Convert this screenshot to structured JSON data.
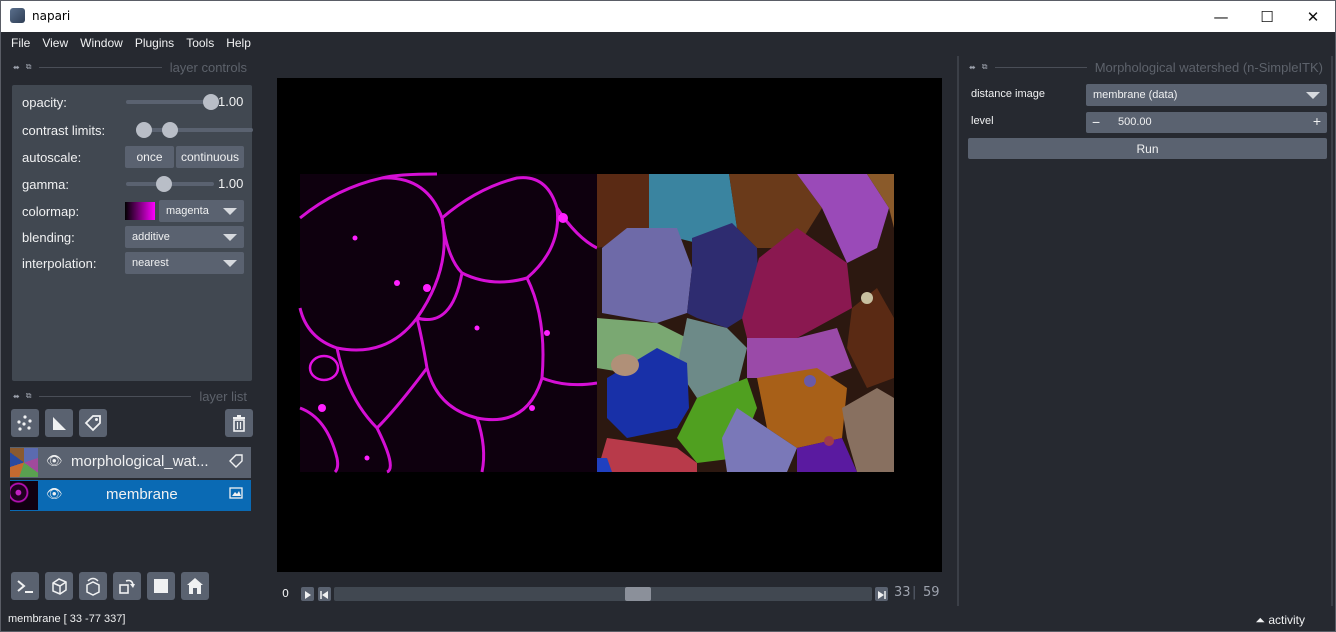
{
  "window": {
    "title": "napari",
    "minimize_glyph": "—",
    "maximize_glyph": "☐",
    "close_glyph": "✕"
  },
  "menu": [
    "File",
    "View",
    "Window",
    "Plugins",
    "Tools",
    "Help"
  ],
  "layer_controls": {
    "header": "layer controls",
    "opacity_label": "opacity:",
    "opacity_value": "1.00",
    "opacity_fraction": 1.0,
    "contrast_label": "contrast limits:",
    "autoscale_label": "autoscale:",
    "autoscale_once": "once",
    "autoscale_continuous": "continuous",
    "gamma_label": "gamma:",
    "gamma_value": "1.00",
    "colormap_label": "colormap:",
    "colormap_value": "magenta",
    "blending_label": "blending:",
    "blending_value": "additive",
    "interpolation_label": "interpolation:",
    "interpolation_value": "nearest"
  },
  "layer_list": {
    "header": "layer list",
    "layers": [
      {
        "name": "morphological_wat...",
        "type_icon": "label-icon",
        "selected": false
      },
      {
        "name": "membrane",
        "type_icon": "image-icon",
        "selected": true
      }
    ]
  },
  "dims": {
    "axis_index": "0",
    "current": "33",
    "total": "59",
    "separator": "|"
  },
  "plugin_panel": {
    "header": "Morphological watershed (n-SimpleITK)",
    "distance_image_label": "distance image",
    "distance_image_value": "membrane (data)",
    "level_label": "level",
    "level_value": "500.00",
    "run_label": "Run"
  },
  "status_bar": {
    "text": "membrane [ 33 -77 337]",
    "activity_label": "activity"
  },
  "colors": {
    "background": "#262930",
    "panel": "#414851",
    "control": "#5a6270",
    "selected": "#0a6ab4",
    "magenta": "#ff00ff"
  }
}
